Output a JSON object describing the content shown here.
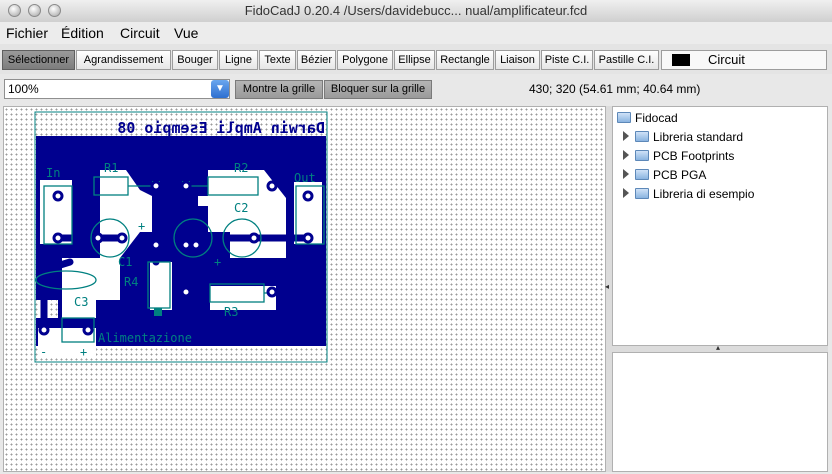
{
  "window": {
    "title": "FidoCadJ 0.20.4 /Users/davidebucc...  nual/amplificateur.fcd"
  },
  "menu": [
    "Fichier",
    "Édition",
    "Circuit",
    "Vue"
  ],
  "toolbar": {
    "tools": [
      "Sélectionner",
      "Agrandissement",
      "Bouger",
      "Ligne",
      "Texte",
      "Bézier",
      "Polygone",
      "Ellipse",
      "Rectangle",
      "Liaison",
      "Piste C.I.",
      "Pastille C.I."
    ],
    "selected": "Sélectionner",
    "layer_label": "Circuit",
    "layer_color": "#000000"
  },
  "controls": {
    "zoom_value": "100%",
    "zoom_arrow_icon": "chevron-down-icon",
    "show_grid_label": "Montre la grille",
    "snap_grid_label": "Bloquer sur la grille",
    "coordinates": "430; 320 (54.61 mm; 40.64 mm)"
  },
  "pcb": {
    "board_color": "#00008f",
    "pad_color": "#ffffff",
    "component_color": "#008080",
    "title_text": "Darwin Ampli Esempio 08",
    "labels": {
      "in": "In",
      "out": "Out",
      "r1": "R1",
      "r2": "R2",
      "r3": "R3",
      "r4": "R4",
      "c1": "C1",
      "c2": "C2",
      "c3": "C3",
      "power": "Alimentazione",
      "minus": "-",
      "plus": "+"
    }
  },
  "library_tree": {
    "root": "Fidocad",
    "items": [
      "Libreria standard",
      "PCB Footprints",
      "PCB PGA",
      "Libreria di esempio"
    ]
  }
}
